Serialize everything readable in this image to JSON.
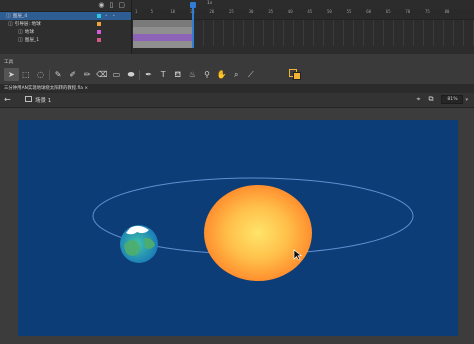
{
  "timeline": {
    "layers": [
      {
        "name": "图层_4",
        "selected": true,
        "swatch": "#2bc7e0"
      },
      {
        "name": "引导层: 地球",
        "selected": false,
        "swatch": "#f0a33a"
      },
      {
        "name": "地球",
        "selected": false,
        "swatch": "#cf5fd8"
      },
      {
        "name": "图层_1",
        "selected": false,
        "swatch": "#d6578a"
      }
    ],
    "ruler_ticks": [
      "1",
      "5",
      "10",
      "15",
      "20",
      "25",
      "30",
      "35",
      "40",
      "45",
      "50",
      "55",
      "60",
      "65",
      "70",
      "75",
      "80"
    ],
    "seconds_marker": "1s"
  },
  "tools": {
    "title": "工具",
    "items": [
      "selection-tool",
      "free-transform-tool",
      "lasso-tool",
      "pencil-tool",
      "paint-brush-tool",
      "brush-tool",
      "eraser-tool",
      "rectangle-tool",
      "oval-tool",
      "pen-tool",
      "text-tool",
      "paint-bucket-tool",
      "ink-bottle-tool",
      "eyedropper-tool",
      "hand-tool",
      "zoom-tool",
      "bone-tool"
    ],
    "stroke_color": "#f3b233",
    "fill_color": "#f3b233"
  },
  "document": {
    "tab_label": "三分钟用AN实现地球绕太阳转的教程.fla ×",
    "scene_label": "场景 1",
    "zoom": "81%"
  },
  "stage": {
    "background": "#0c3d76",
    "sun_color": "#ffb23a",
    "orbit_color": "#5f8fd0"
  }
}
